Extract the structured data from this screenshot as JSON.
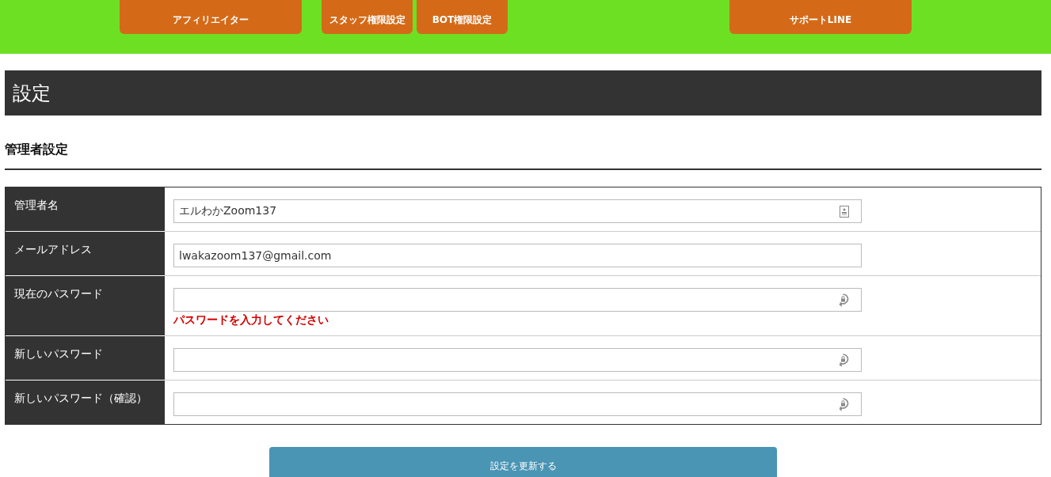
{
  "nav_buttons": [
    "アフィリエイター",
    "スタッフ権限設定",
    "BOT権限設定",
    "サポートLINE"
  ],
  "page_title": "設定",
  "section_title": "管理者設定",
  "form_rows": [
    {
      "label": "管理者名",
      "kind": "contact",
      "value": "エルわかZoom137"
    },
    {
      "label": "メールアドレス",
      "kind": "plain",
      "value": "lwakazoom137@gmail.com"
    },
    {
      "label": "現在のパスワード",
      "kind": "password",
      "value": "",
      "error": "パスワードを入力してください"
    },
    {
      "label": "新しいパスワード",
      "kind": "password",
      "value": ""
    },
    {
      "label": "新しいパスワード（確認）",
      "kind": "password",
      "value": ""
    }
  ],
  "submit_button": "設定を更新する"
}
